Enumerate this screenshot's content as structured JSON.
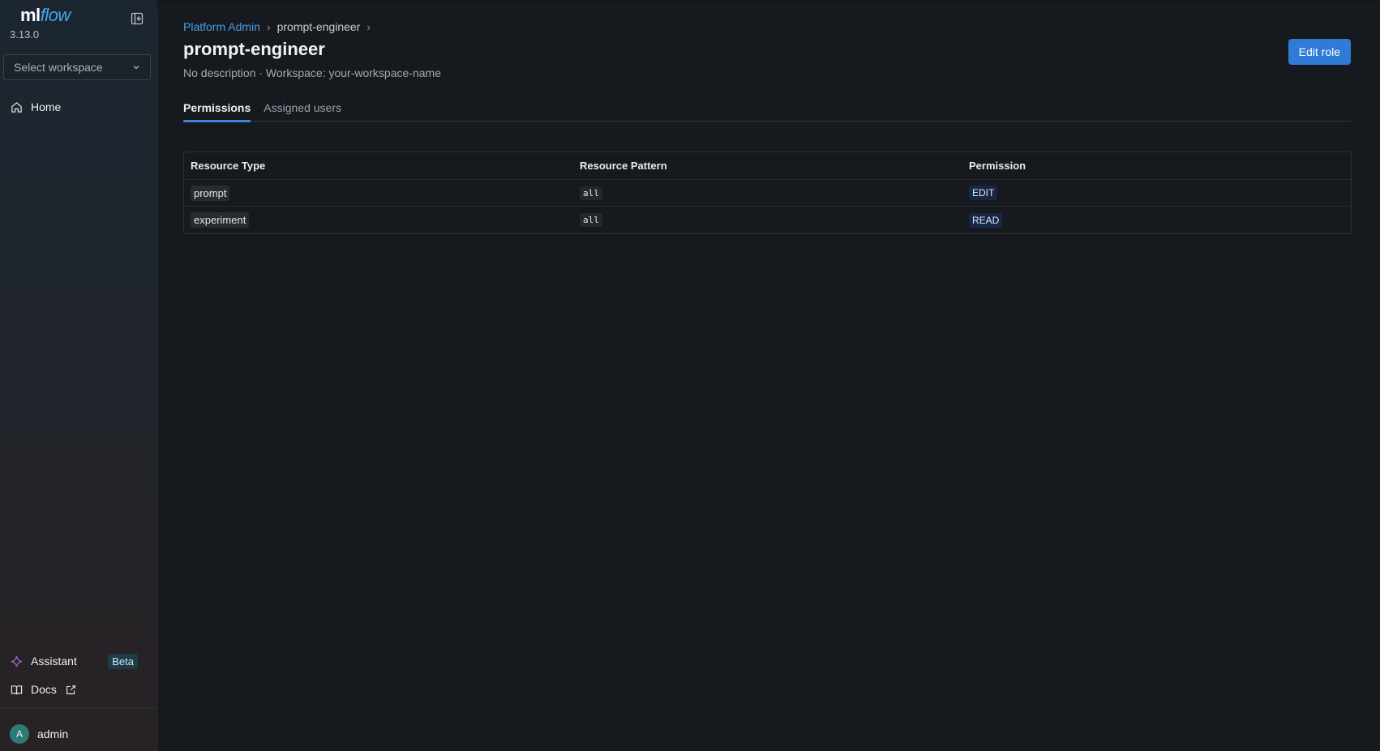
{
  "app": {
    "logo_ml": "ml",
    "logo_flow": "flow",
    "version": "3.13.0"
  },
  "sidebar": {
    "workspace_placeholder": "Select workspace",
    "items": [
      {
        "label": "Home",
        "icon": "home-icon"
      }
    ],
    "bottom": {
      "assistant_label": "Assistant",
      "assistant_badge": "Beta",
      "docs_label": "Docs",
      "user_initial": "A",
      "user_name": "admin"
    }
  },
  "breadcrumb": {
    "root": "Platform Admin",
    "current": "prompt-engineer"
  },
  "page": {
    "title": "prompt-engineer",
    "subtitle": "No description · Workspace: your-workspace-name",
    "edit_button": "Edit role"
  },
  "tabs": [
    {
      "label": "Permissions",
      "active": true
    },
    {
      "label": "Assigned users",
      "active": false
    }
  ],
  "table": {
    "headers": [
      "Resource Type",
      "Resource Pattern",
      "Permission"
    ],
    "rows": [
      {
        "type": "prompt",
        "pattern": "all",
        "permission": "EDIT"
      },
      {
        "type": "experiment",
        "pattern": "all",
        "permission": "READ"
      }
    ]
  },
  "colors": {
    "accent": "#2f7bd6",
    "link": "#4a9fe0",
    "permission_badge_bg": "#182744"
  }
}
